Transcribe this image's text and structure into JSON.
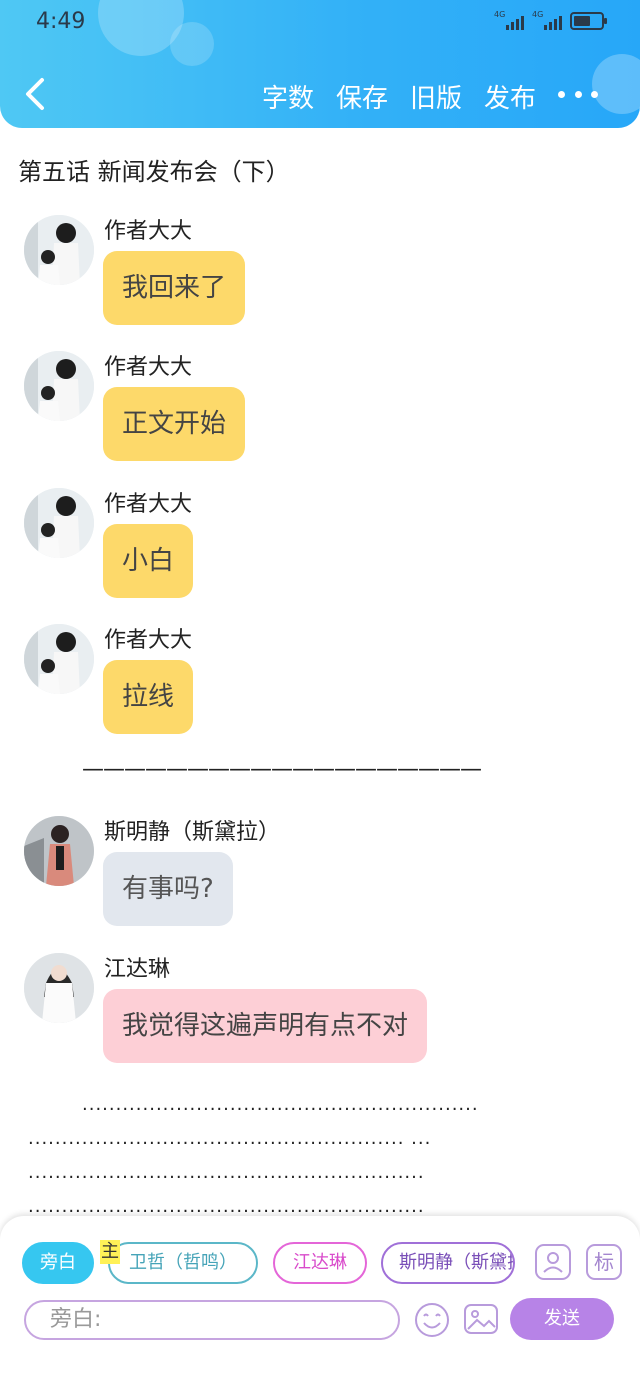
{
  "status_bar": {
    "time": "4:49",
    "network_labels": [
      "4G",
      "4G"
    ]
  },
  "header": {
    "actions": [
      "字数",
      "保存",
      "旧版",
      "发布"
    ],
    "more_icon": "more-horizontal-icon",
    "back_icon": "chevron-left-icon"
  },
  "chapter_title": "第五话 新闻发布会（下）",
  "messages": [
    {
      "speaker": "作者大大",
      "text": "我回来了",
      "style": "yellow"
    },
    {
      "speaker": "作者大大",
      "text": "正文开始",
      "style": "yellow"
    },
    {
      "speaker": "作者大大",
      "text": "小白",
      "style": "yellow"
    },
    {
      "speaker": "作者大大",
      "text": "拉线",
      "style": "yellow"
    },
    {
      "speaker": "斯明静（斯黛拉）",
      "text": "有事吗?",
      "style": "grey"
    },
    {
      "speaker": "江达琳",
      "text": "我觉得这遍声明有点不对",
      "style": "pink"
    }
  ],
  "divider": "———————————————————",
  "dot_lines": [
    "...........................................................",
    "........................................................ ...",
    "...........................................................",
    "..........................................................."
  ],
  "editor": {
    "chips": [
      "旁白",
      "卫哲（哲鸣）",
      "江达琳",
      "斯明静（斯黛拉）"
    ],
    "main_tag": "主",
    "mark_label": "标",
    "input_placeholder": "旁白:",
    "send_label": "发送"
  },
  "colors": {
    "header_gradient_start": "#4fc8f4",
    "header_gradient_end": "#27a7f8",
    "bubble_yellow": "#fdd96a",
    "bubble_grey": "#e2e7ee",
    "bubble_pink": "#fdcfd6",
    "send_button": "#b783e7"
  }
}
